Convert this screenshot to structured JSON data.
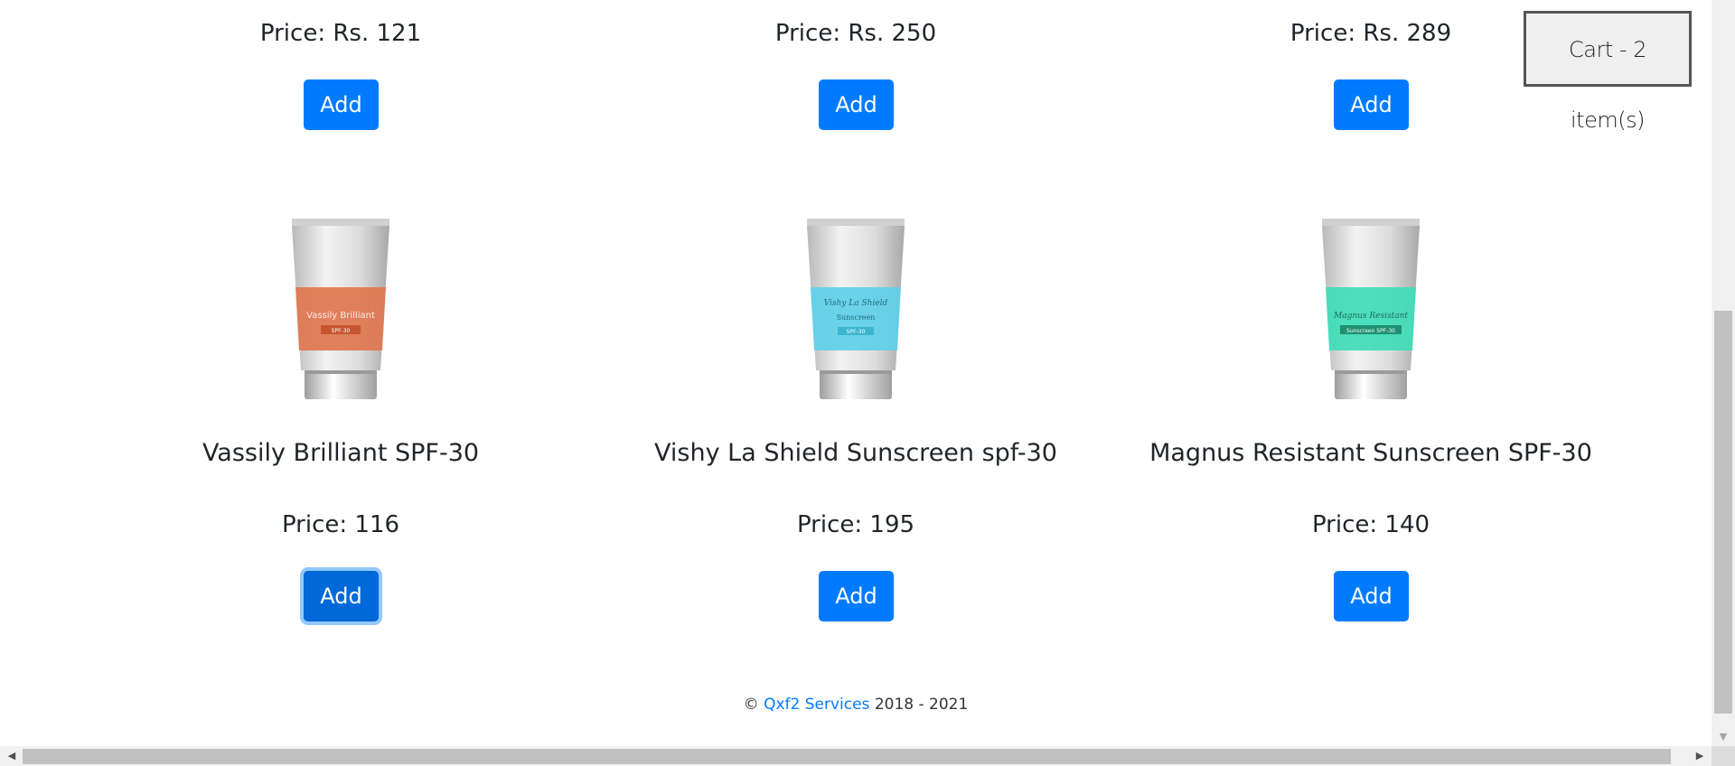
{
  "cart": {
    "label": "Cart - 2 item(s)"
  },
  "top_row": [
    {
      "price": "Price: Rs. 121",
      "add_label": "Add"
    },
    {
      "price": "Price: Rs. 250",
      "add_label": "Add"
    },
    {
      "price": "Price: Rs. 289",
      "add_label": "Add"
    }
  ],
  "products": [
    {
      "name": "Vassily Brilliant SPF-30",
      "price": "Price: 116",
      "add_label": "Add",
      "tube_color": "#e0764f",
      "tube_text": "Vassily Brilliant",
      "tube_badge": "SPF-30",
      "image_icon": "sunscreen-tube-orange"
    },
    {
      "name": "Vishy La Shield Sunscreen spf-30",
      "price": "Price: 195",
      "add_label": "Add",
      "tube_color": "#5fd0e8",
      "tube_text": "Vishy La Shield",
      "tube_text2": "Sunscreen",
      "tube_badge": "SPF-30",
      "image_icon": "sunscreen-tube-blue"
    },
    {
      "name": "Magnus Resistant Sunscreen SPF-30",
      "price": "Price: 140",
      "add_label": "Add",
      "tube_color": "#3fdcb6",
      "tube_text": "Magnus Resistant",
      "tube_badge": "Sunscreen SPF-30",
      "image_icon": "sunscreen-tube-green"
    }
  ],
  "footer": {
    "copyright": "©",
    "link_text": "Qxf2 Services",
    "years": "2018 - 2021"
  }
}
